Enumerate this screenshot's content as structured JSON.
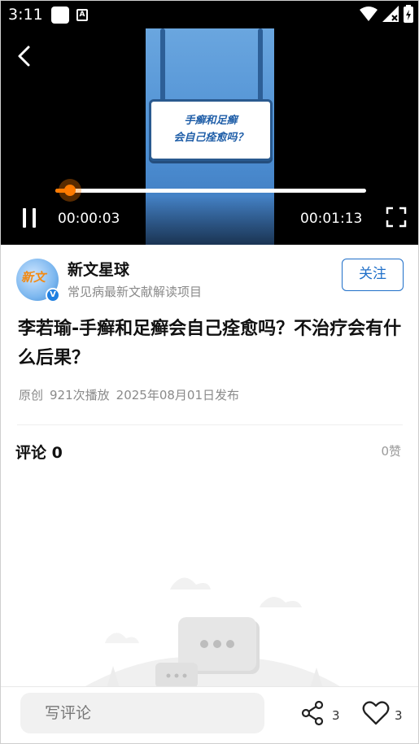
{
  "status_bar": {
    "time": "3:11"
  },
  "video": {
    "sign_line1": "手癣和足癣",
    "sign_line2": "会自己痊愈吗？",
    "current_time": "00:00:03",
    "total_time": "00:01:13",
    "progress_fraction": 0.047
  },
  "author": {
    "name": "新文星球",
    "description": "常见病最新文献解读项目",
    "avatar_text": "新文",
    "verified_mark": "V",
    "follow_label": "关注"
  },
  "article": {
    "title": "李若瑜-手癣和足癣会自己痊愈吗？不治疗会有什么后果？",
    "meta": [
      "原创",
      "921次播放",
      "2025年08月01日发布"
    ]
  },
  "comments": {
    "heading": "评论 0",
    "likes": "0赞"
  },
  "bottom_bar": {
    "comment_placeholder": "写评论",
    "share_count": "3",
    "like_count": "3"
  },
  "colors": {
    "accent": "#1f6fc9",
    "progress": "#ff7a00"
  }
}
